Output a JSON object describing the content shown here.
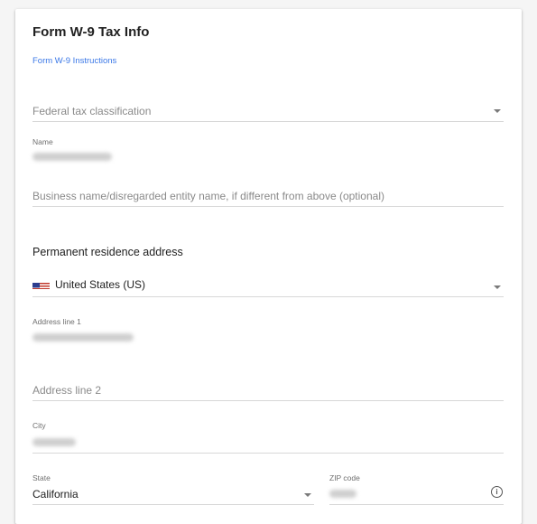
{
  "form": {
    "title": "Form W-9 Tax Info",
    "instructions_link": "Form W-9 Instructions"
  },
  "fields": {
    "federal_tax_classification": {
      "placeholder": "Federal tax classification"
    },
    "name": {
      "label": "Name"
    },
    "business_name": {
      "placeholder": "Business name/disregarded entity name, if different from above (optional)"
    },
    "address_section_title": "Permanent residence address",
    "country": {
      "value": "United States (US)",
      "flag_icon": "us-flag-icon"
    },
    "address_line_1": {
      "label": "Address line 1"
    },
    "address_line_2": {
      "placeholder": "Address line 2"
    },
    "city": {
      "label": "City"
    },
    "state": {
      "label": "State",
      "value": "California"
    },
    "zip": {
      "label": "ZIP code",
      "info_icon": "info-icon"
    }
  },
  "colors": {
    "accent_link": "#3b78e7",
    "underline": "#d7d7d7",
    "placeholder": "#8a8a8a"
  }
}
